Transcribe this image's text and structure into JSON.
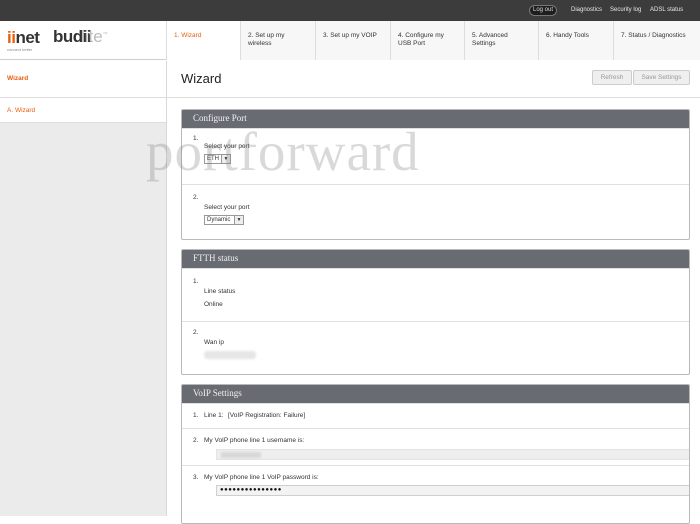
{
  "topbar": {
    "logout": "Log out",
    "links": [
      "Diagnostics",
      "Security log",
      "ADSL status"
    ]
  },
  "logo": {
    "ii": "ii",
    "net": "net",
    "tagline": "connect better",
    "budii": "budii",
    "lite": "lite",
    "tm": "™"
  },
  "tabs": [
    {
      "label": "1. Wizard",
      "active": true
    },
    {
      "label": "2. Set up my wireless",
      "active": false
    },
    {
      "label": "3. Set up my VOIP",
      "active": false
    },
    {
      "label": "4. Configure my USB Port",
      "active": false
    },
    {
      "label": "5. Advanced Settings",
      "active": false
    },
    {
      "label": "6. Handy Tools",
      "active": false
    },
    {
      "label": "7. Status / Diagnostics",
      "active": false
    }
  ],
  "sidebar": {
    "heading": "Wizard",
    "items": [
      {
        "label": "A. Wizard"
      }
    ]
  },
  "main": {
    "title": "Wizard",
    "refresh": "Refresh",
    "save": "Save Settings"
  },
  "configure_port": {
    "title": "Configure Port",
    "rows": [
      {
        "num": "1.",
        "label": "Select your port",
        "value": "ETH"
      },
      {
        "num": "2.",
        "label": "Select your port",
        "value": "Dynamic"
      }
    ]
  },
  "ftth_status": {
    "title": "FTTH status",
    "rows": [
      {
        "num": "1.",
        "label": "Line status",
        "value": "Online"
      },
      {
        "num": "2.",
        "label": "Wan ip",
        "value": ""
      }
    ]
  },
  "voip": {
    "title": "VoIP Settings",
    "rows": [
      {
        "num": "1.",
        "line": "Line 1:",
        "status": "[VoIP Registration: Failure]"
      },
      {
        "num": "2.",
        "label": "My VoIP phone line 1 username is:"
      },
      {
        "num": "3.",
        "label": "My VoIP phone line 1 VoIP password is:",
        "value": "●●●●●●●●●●●●●●●"
      }
    ]
  },
  "watermark": "portforward",
  "colors": {
    "accent": "#e95d0f",
    "panel_header": "#686c72",
    "topbar": "#3c3c3c"
  }
}
